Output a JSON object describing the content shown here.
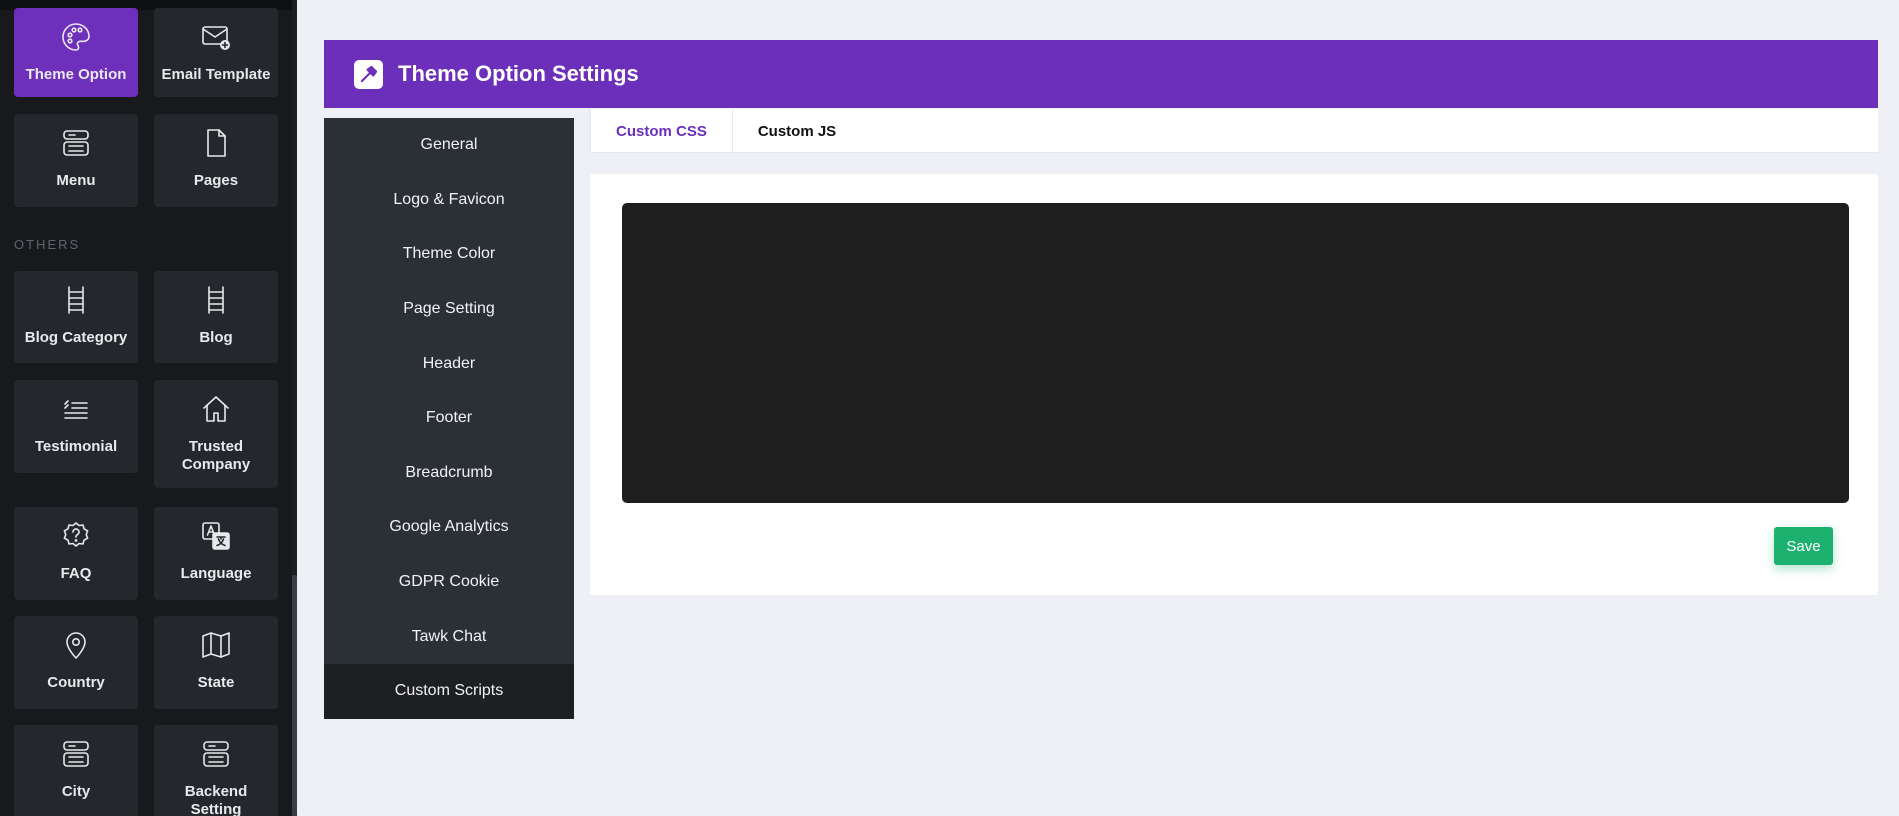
{
  "sidebar": {
    "section_label": "OTHERS",
    "tiles": [
      {
        "label": "Theme Option",
        "icon": "palette-icon",
        "active": true
      },
      {
        "label": "Email Template",
        "icon": "email-add-icon"
      },
      {
        "label": "Menu",
        "icon": "menu-server-icon"
      },
      {
        "label": "Pages",
        "icon": "page-icon"
      },
      {
        "label": "Blog Category",
        "icon": "ladder-icon"
      },
      {
        "label": "Blog",
        "icon": "ladder-icon"
      },
      {
        "label": "Testimonial",
        "icon": "quote-lines-icon"
      },
      {
        "label": "Trusted Company",
        "icon": "house-icon"
      },
      {
        "label": "FAQ",
        "icon": "question-badge-icon"
      },
      {
        "label": "Language",
        "icon": "translate-icon"
      },
      {
        "label": "Country",
        "icon": "map-pin-icon"
      },
      {
        "label": "State",
        "icon": "map-icon"
      },
      {
        "label": "City",
        "icon": "server-icon"
      },
      {
        "label": "Backend Setting",
        "icon": "server-icon"
      }
    ]
  },
  "header": {
    "title": "Theme Option Settings",
    "icon": "hammer-icon"
  },
  "settings_menu": {
    "items": [
      "General",
      "Logo & Favicon",
      "Theme Color",
      "Page Setting",
      "Header",
      "Footer",
      "Breadcrumb",
      "Google Analytics",
      "GDPR Cookie",
      "Tawk Chat",
      "Custom Scripts"
    ],
    "active": "Custom Scripts"
  },
  "tabs": [
    {
      "label": "Custom CSS",
      "active": true
    },
    {
      "label": "Custom JS",
      "active": false
    }
  ],
  "editor": {
    "value": ""
  },
  "actions": {
    "save_label": "Save"
  },
  "colors": {
    "accent": "#6c2fb9",
    "save": "#1db16f",
    "sidebar_bg": "#17191d",
    "menu_bg": "#2b3036",
    "editor_bg": "#1e1e1e"
  }
}
